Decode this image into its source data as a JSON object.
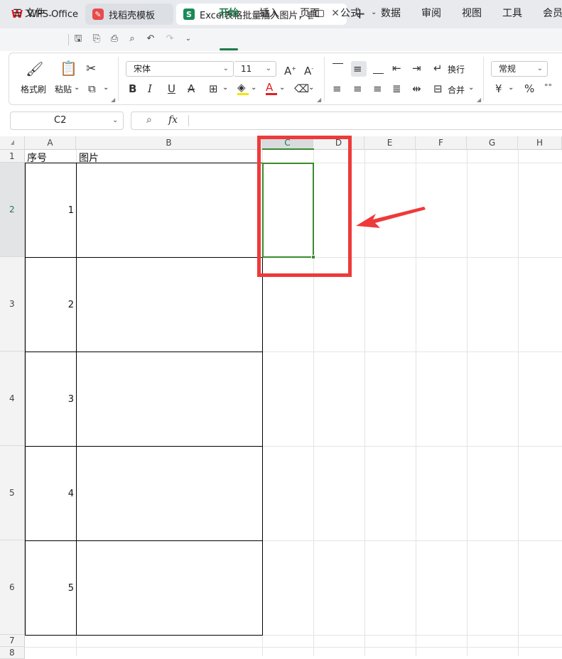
{
  "tabs": {
    "wps": {
      "label": "WPS Office",
      "icon": "wps-logo-icon"
    },
    "daoke": {
      "label": "找稻壳模板",
      "icon": "daoke-logo-icon"
    },
    "excel": {
      "label": "Excel表格批量插入图片，自动",
      "icon_glyph": "S"
    }
  },
  "menu": {
    "file": "文件",
    "tabs": [
      "开始",
      "插入",
      "页面",
      "公式",
      "数据",
      "审阅",
      "视图",
      "工具",
      "会员"
    ],
    "active": "开始"
  },
  "ribbon": {
    "format_painter": "格式刷",
    "paste": "粘贴",
    "font_name": "宋体",
    "font_size": "11",
    "wrap": "换行",
    "merge": "合并",
    "number_format": "常规",
    "currency": "¥",
    "percent": "%"
  },
  "formula_bar": {
    "cell_ref": "C2",
    "fx": "fx",
    "value": ""
  },
  "sheet": {
    "columns": [
      "A",
      "B",
      "C",
      "D",
      "E",
      "F",
      "G",
      "H"
    ],
    "rows": [
      "1",
      "2",
      "3",
      "4",
      "5",
      "6",
      "7",
      "8"
    ],
    "header_seq": "序号",
    "header_image": "图片",
    "seq_values": [
      "1",
      "2",
      "3",
      "4",
      "5"
    ],
    "selected_cell": "C2"
  },
  "colors": {
    "accent_green": "#1f7a4a",
    "selection_green": "#3a8a2e",
    "annotation_red": "#ee3a3a"
  }
}
